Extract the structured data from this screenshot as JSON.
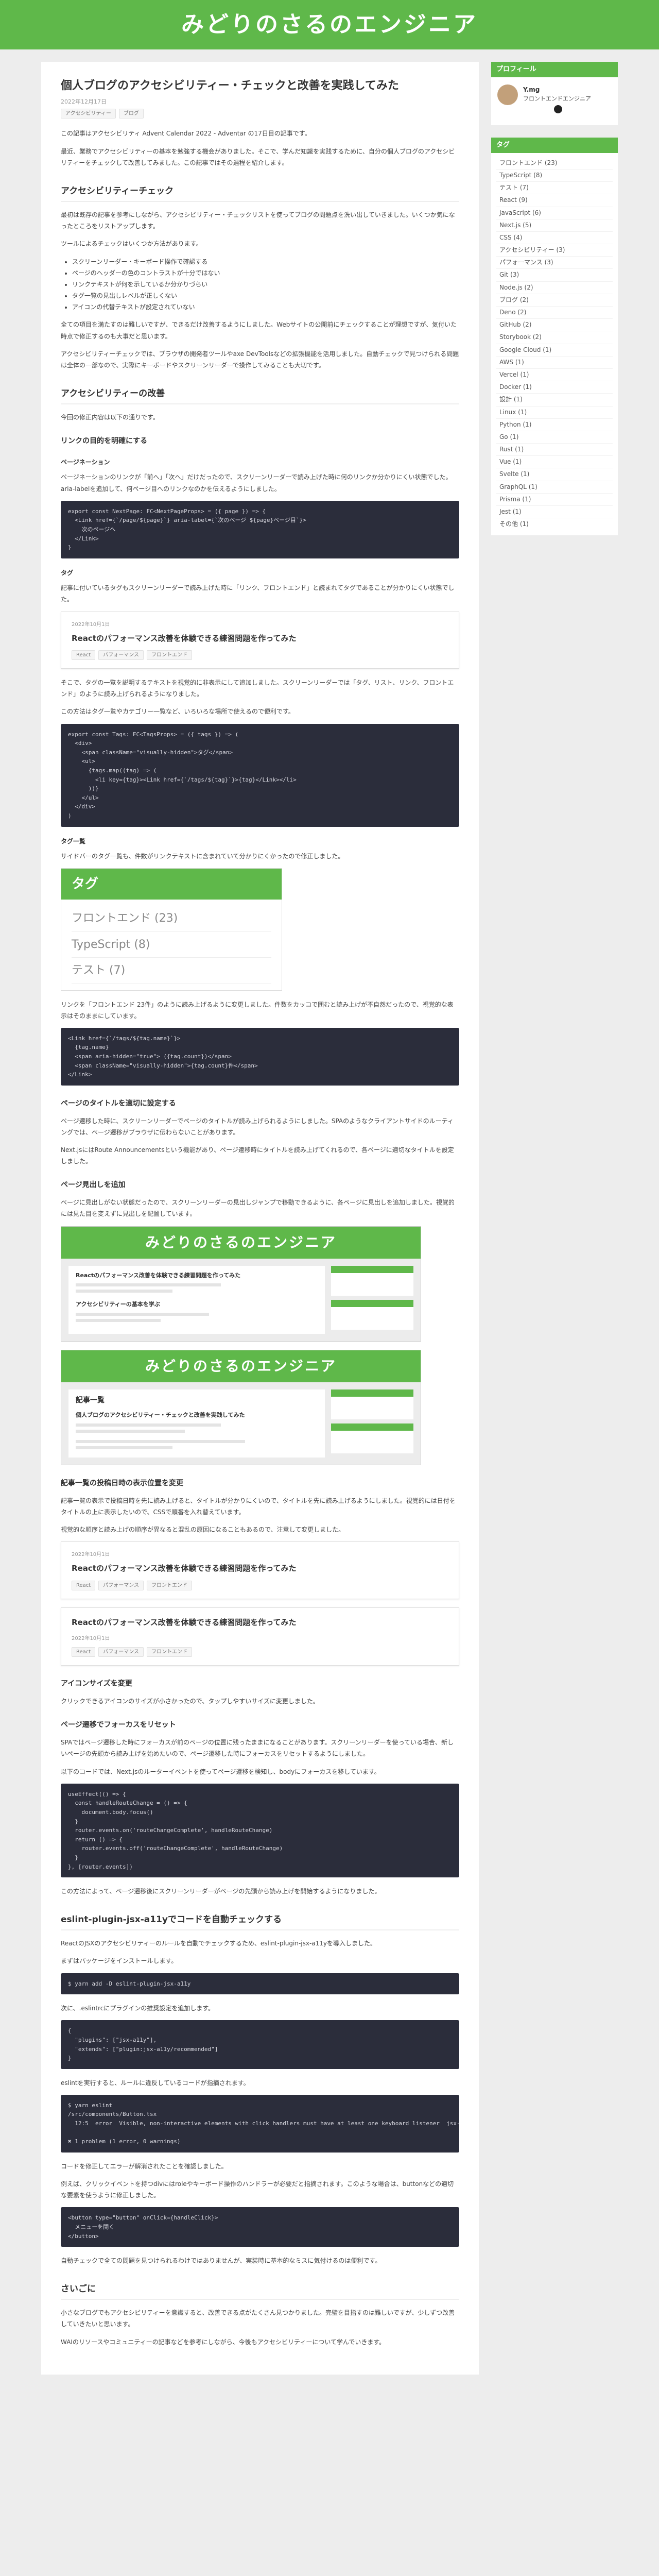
{
  "site": {
    "title": "みどりのさるのエンジニア"
  },
  "post": {
    "title": "個人ブログのアクセシビリティー・チェックと改善を実践してみた",
    "date": "2022年12月17日",
    "tags": [
      "アクセシビリティー",
      "ブログ"
    ],
    "intro1": "この記事はアクセシビリティ Advent Calendar 2022 - Adventar の17日目の記事です。",
    "intro2": "最近、業務でアクセシビリティーの基本を勉強する機会がありました。そこで、学んだ知識を実践するために、自分の個人ブログのアクセシビリティーをチェックして改善してみました。この記事ではその過程を紹介します。",
    "h_check": "アクセシビリティーチェック",
    "check_p1": "最初は既存の記事を参考にしながら、アクセシビリティー・チェックリストを使ってブログの問題点を洗い出していきました。いくつか気になったところをリストアップします。",
    "check_p2": "ツールによるチェックはいくつか方法があります。",
    "check_list": [
      "スクリーンリーダー・キーボード操作で確認する",
      "ページのヘッダーの色のコントラストが十分ではない",
      "リンクテキストが何を示しているか分かりづらい",
      "タグ一覧の見出しレベルが正しくない",
      "アイコンの代替テキストが設定されていない"
    ],
    "check_p3": "全ての項目を満たすのは難しいですが、できるだけ改善するようにしました。Webサイトの公開前にチェックすることが理想ですが、気付いた時点で修正するのも大事だと思います。",
    "check_p4": "アクセシビリティーチェックでは、ブラウザの開発者ツールやaxe DevToolsなどの拡張機能を活用しました。自動チェックで見つけられる問題は全体の一部なので、実際にキーボードやスクリーンリーダーで操作してみることも大切です。",
    "h_improve": "アクセシビリティーの改善",
    "improve_p1": "今回の修正内容は以下の通りです。",
    "h_link": "リンクの目的を明確にする",
    "h_pagination": "ページネーション",
    "pagination_p": "ページネーションのリンクが「前へ」「次へ」だけだったので、スクリーンリーダーで読み上げた時に何のリンクか分かりにくい状態でした。aria-labelを追加して、何ページ目へのリンクなのかを伝えるようにしました。",
    "h_tag": "タグ",
    "tag_p": "記事に付いているタグもスクリーンリーダーで読み上げた時に「リンク、フロントエンド」と読まれてタグであることが分かりにくい状態でした。",
    "card1": {
      "date": "2022年10月1日",
      "title": "Reactのパフォーマンス改善を体験できる練習問題を作ってみた",
      "tags": [
        "React",
        "パフォーマンス",
        "フロントエンド"
      ]
    },
    "tag_p2": "そこで、タグの一覧を説明するテキストを視覚的に非表示にして追加しました。スクリーンリーダーでは「タグ、リスト、リンク、フロントエンド」のように読み上げられるようになりました。",
    "tag_p3": "この方法はタグ一覧やカテゴリー一覧など、いろいろな場所で使えるので便利です。",
    "h_taglist": "タグ一覧",
    "taglist_p": "サイドバーのタグ一覧も、件数がリンクテキストに含まれていて分かりにくかったので修正しました。",
    "tagwidget": {
      "title": "タグ",
      "items": [
        "フロントエンド (23)",
        "TypeScript (8)",
        "テスト (7)"
      ]
    },
    "taglist_p2": "リンクを「フロントエンド 23件」のように読み上げるように変更しました。件数をカッコで囲むと読み上げが不自然だったので、視覚的な表示はそのままにしています。",
    "h_title": "ページのタイトルを適切に設定する",
    "title_p1": "ページ遷移した時に、スクリーンリーダーでページのタイトルが読み上げられるようにしました。SPAのようなクライアントサイドのルーティングでは、ページ遷移がブラウザに伝わらないことがあります。",
    "title_p2": "Next.jsにはRoute Announcementsという機能があり、ページ遷移時にタイトルを読み上げてくれるので、各ページに適切なタイトルを設定しました。",
    "h_heading": "ページ見出しを追加",
    "heading_p": "ページに見出しがない状態だったので、スクリーンリーダーの見出しジャンプで移動できるように、各ページに見出しを追加しました。視覚的には見た目を変えずに見出しを配置しています。",
    "shot1": {
      "header": "みどりのさるのエンジニア",
      "item_title": "Reactのパフォーマンス改善を体験できる練習問題を作ってみた",
      "item_title2": "アクセシビリティーの基本を学ぶ"
    },
    "shot2": {
      "header": "みどりのさるのエンジニア",
      "heading": "記事一覧",
      "item_title": "個人ブログのアクセシビリティー・チェックと改善を実践してみた"
    },
    "h_order": "記事一覧の投稿日時の表示位置を変更",
    "order_p1": "記事一覧の表示で投稿日時を先に読み上げると、タイトルが分かりにくいので、タイトルを先に読み上げるようにしました。視覚的には日付をタイトルの上に表示したいので、CSSで順番を入れ替えています。",
    "order_p2": "視覚的な順序と読み上げの順序が異なると混乱の原因になることもあるので、注意して変更しました。",
    "card2": {
      "date": "2022年10月1日",
      "title": "Reactのパフォーマンス改善を体験できる練習問題を作ってみた",
      "tags": [
        "React",
        "パフォーマンス",
        "フロントエンド"
      ]
    },
    "card3": {
      "title": "Reactのパフォーマンス改善を体験できる練習問題を作ってみた",
      "date": "2022年10月1日",
      "tags": [
        "React",
        "パフォーマンス",
        "フロントエンド"
      ]
    },
    "h_icon": "アイコンサイズを変更",
    "icon_p": "クリックできるアイコンのサイズが小さかったので、タップしやすいサイズに変更しました。",
    "h_focus": "ページ遷移でフォーカスをリセット",
    "focus_p1": "SPAではページ遷移した時にフォーカスが前のページの位置に残ったままになることがあります。スクリーンリーダーを使っている場合、新しいページの先頭から読み上げを始めたいので、ページ遷移した時にフォーカスをリセットするようにしました。",
    "focus_p2": "以下のコードでは、Next.jsのルーターイベントを使ってページ遷移を検知し、bodyにフォーカスを移しています。",
    "focus_p3": "この方法によって、ページ遷移後にスクリーンリーダーがページの先頭から読み上げを開始するようになりました。",
    "h_eslint": "eslint-plugin-jsx-a11yでコードを自動チェックする",
    "eslint_p1": "ReactのJSXのアクセシビリティーのルールを自動でチェックするため、eslint-plugin-jsx-a11yを導入しました。",
    "eslint_p2": "まずはパッケージをインストールします。",
    "eslint_p3": "次に、.eslintrcにプラグインの推奨設定を追加します。",
    "eslint_p4": "eslintを実行すると、ルールに違反しているコードが指摘されます。",
    "eslint_p5": "コードを修正してエラーが解消されたことを確認しました。",
    "eslint_p6": "例えば、クリックイベントを持つdivにはroleやキーボード操作のハンドラーが必要だと指摘されます。このような場合は、buttonなどの適切な要素を使うように修正しました。",
    "eslint_p7": "自動チェックで全ての問題を見つけられるわけではありませんが、実装時に基本的なミスに気付けるのは便利です。",
    "h_end": "さいごに",
    "end_p1": "小さなブログでもアクセシビリティーを意識すると、改善できる点がたくさん見つかりました。完璧を目指すのは難しいですが、少しずつ改善していきたいと思います。",
    "end_p2": "WAIのリソースやコミュニティーの記事などを参考にしながら、今後もアクセシビリティーについて学んでいきます。"
  },
  "code": {
    "pagination": "export const NextPage: FC<NextPageProps> = ({ page }) => {\n  <Link href={`/page/${page}`} aria-label={`次のページ ${page}ページ目`}>\n    次のページへ\n  </Link>\n}",
    "tag": "export const Tags: FC<TagsProps> = ({ tags }) => (\n  <div>\n    <span className=\"visually-hidden\">タグ</span>\n    <ul>\n      {tags.map((tag) => (\n        <li key={tag}><Link href={`/tags/${tag}`}>{tag}</Link></li>\n      ))}\n    </ul>\n  </div>\n)",
    "taglist": "<Link href={`/tags/${tag.name}`}>\n  {tag.name}\n  <span aria-hidden=\"true\"> ({tag.count})</span>\n  <span className=\"visually-hidden\">{tag.count}件</span>\n</Link>",
    "focus": "useEffect(() => {\n  const handleRouteChange = () => {\n    document.body.focus()\n  }\n  router.events.on('routeChangeComplete', handleRouteChange)\n  return () => {\n    router.events.off('routeChangeComplete', handleRouteChange)\n  }\n}, [router.events])",
    "install": "$ yarn add -D eslint-plugin-jsx-a11y",
    "eslintrc": "{\n  \"plugins\": [\"jsx-a11y\"],\n  \"extends\": [\"plugin:jsx-a11y/recommended\"]\n}",
    "result": "$ yarn eslint\n/src/components/Button.tsx\n  12:5  error  Visible, non-interactive elements with click handlers must have at least one keyboard listener  jsx-a11y/click-events-have-key-events\n\n✖ 1 problem (1 error, 0 warnings)",
    "fixed": "<button type=\"button\" onClick={handleClick}>\n  メニューを開く\n</button>"
  },
  "sidebar": {
    "profile": {
      "title": "プロフィール",
      "name": "Y.mg",
      "desc": "フロントエンドエンジニア"
    },
    "tags": {
      "title": "タグ",
      "items": [
        "フロントエンド (23)",
        "TypeScript (8)",
        "テスト (7)",
        "React (9)",
        "JavaScript (6)",
        "Next.js (5)",
        "CSS (4)",
        "アクセシビリティー (3)",
        "パフォーマンス (3)",
        "Git (3)",
        "Node.js (2)",
        "ブログ (2)",
        "Deno (2)",
        "GitHub (2)",
        "Storybook (2)",
        "Google Cloud (1)",
        "AWS (1)",
        "Vercel (1)",
        "Docker (1)",
        "設計 (1)",
        "Linux (1)",
        "Python (1)",
        "Go (1)",
        "Rust (1)",
        "Vue (1)",
        "Svelte (1)",
        "GraphQL (1)",
        "Prisma (1)",
        "Jest (1)",
        "その他 (1)"
      ]
    }
  }
}
